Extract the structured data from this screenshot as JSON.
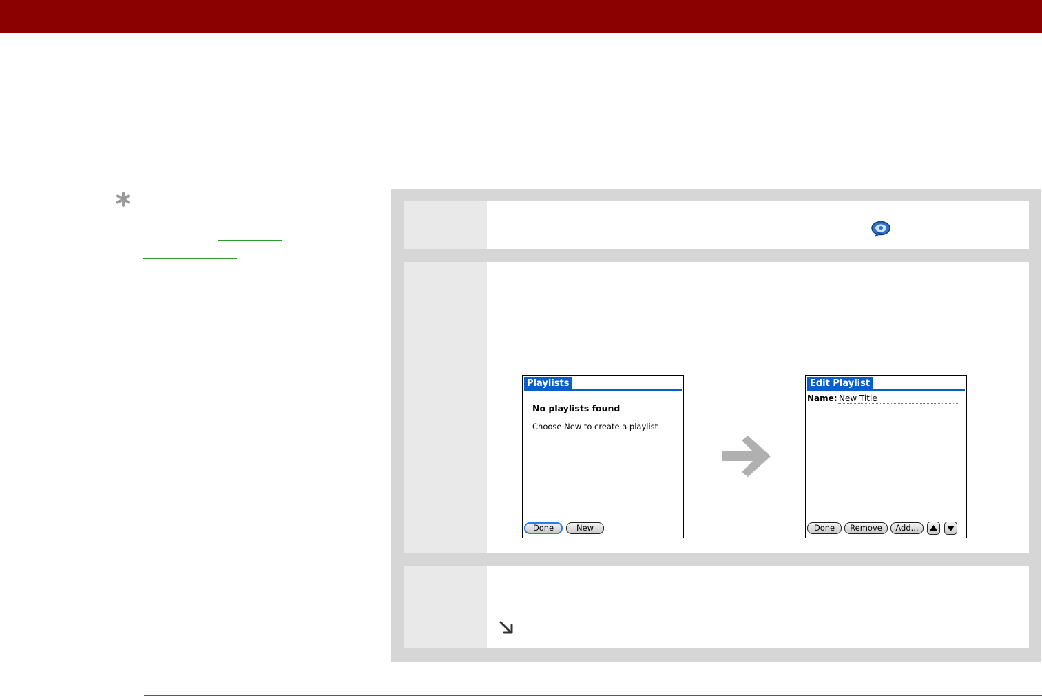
{
  "colors": {
    "header_bar": "#8b0000",
    "link": "#2a9a2a",
    "panel_bg": "#d6d6d6",
    "step_number_bg": "#e9e9e9",
    "palm_title_blue": "#0a5ec9",
    "arrow_gray": "#b0b0b0"
  },
  "icons": {
    "tip": "asterisk-icon",
    "app": "speech-bubble-icon",
    "next_arrow": "right-arrow-icon",
    "continued": "down-right-arrow-icon"
  },
  "screens": {
    "playlists": {
      "title": "Playlists",
      "heading": "No playlists found",
      "message": "Choose New to create a playlist",
      "buttons": {
        "done": "Done",
        "new": "New"
      }
    },
    "edit_playlist": {
      "title": "Edit Playlist",
      "name_label": "Name:",
      "name_value": "New Title",
      "buttons": {
        "done": "Done",
        "remove": "Remove",
        "add": "Add..."
      }
    }
  }
}
